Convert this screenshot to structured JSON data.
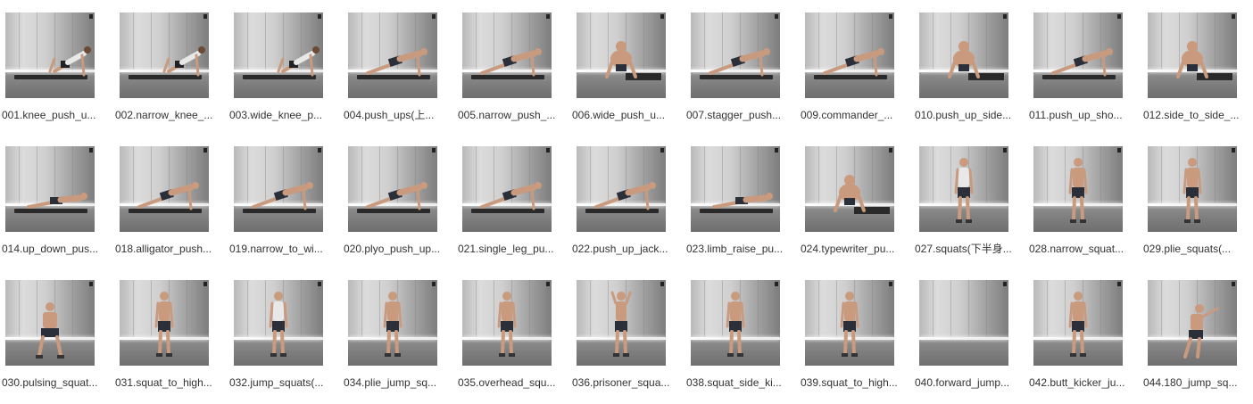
{
  "files": [
    {
      "label": "001.knee_push_u...",
      "pose": "plank-knee",
      "figure": "female"
    },
    {
      "label": "002.narrow_knee_...",
      "pose": "plank-knee",
      "figure": "female"
    },
    {
      "label": "003.wide_knee_p...",
      "pose": "plank-knee",
      "figure": "female"
    },
    {
      "label": "004.push_ups(上...",
      "pose": "plank",
      "figure": "male"
    },
    {
      "label": "005.narrow_push_...",
      "pose": "plank",
      "figure": "male"
    },
    {
      "label": "006.wide_push_u...",
      "pose": "plank-front",
      "figure": "male"
    },
    {
      "label": "007.stagger_push...",
      "pose": "plank",
      "figure": "male"
    },
    {
      "label": "009.commander_...",
      "pose": "plank",
      "figure": "male"
    },
    {
      "label": "010.push_up_side...",
      "pose": "plank-front",
      "figure": "male"
    },
    {
      "label": "011.push_up_sho...",
      "pose": "plank",
      "figure": "male"
    },
    {
      "label": "012.side_to_side_...",
      "pose": "plank-front",
      "figure": "male"
    },
    {
      "label": "014.up_down_pus...",
      "pose": "plank-low",
      "figure": "male"
    },
    {
      "label": "018.alligator_push...",
      "pose": "plank",
      "figure": "male"
    },
    {
      "label": "019.narrow_to_wi...",
      "pose": "plank",
      "figure": "male"
    },
    {
      "label": "020.plyo_push_up...",
      "pose": "plank",
      "figure": "male"
    },
    {
      "label": "021.single_leg_pu...",
      "pose": "plank",
      "figure": "male"
    },
    {
      "label": "022.push_up_jack...",
      "pose": "plank",
      "figure": "male"
    },
    {
      "label": "023.limb_raise_pu...",
      "pose": "plank-low",
      "figure": "male"
    },
    {
      "label": "024.typewriter_pu...",
      "pose": "plank-front",
      "figure": "male"
    },
    {
      "label": "027.squats(下半身...",
      "pose": "stand",
      "figure": "female"
    },
    {
      "label": "028.narrow_squat...",
      "pose": "stand",
      "figure": "male"
    },
    {
      "label": "029.plie_squats(...",
      "pose": "stand",
      "figure": "male"
    },
    {
      "label": "030.pulsing_squat...",
      "pose": "squat",
      "figure": "male"
    },
    {
      "label": "031.squat_to_high...",
      "pose": "stand",
      "figure": "male"
    },
    {
      "label": "032.jump_squats(...",
      "pose": "stand",
      "figure": "female"
    },
    {
      "label": "034.plie_jump_sq...",
      "pose": "stand",
      "figure": "male"
    },
    {
      "label": "035.overhead_squ...",
      "pose": "stand",
      "figure": "male"
    },
    {
      "label": "036.prisoner_squa...",
      "pose": "stand-arms",
      "figure": "male"
    },
    {
      "label": "038.squat_side_ki...",
      "pose": "stand",
      "figure": "male"
    },
    {
      "label": "039.squat_to_high...",
      "pose": "stand-front",
      "figure": "male"
    },
    {
      "label": "040.forward_jump...",
      "pose": "empty",
      "figure": "none"
    },
    {
      "label": "042.butt_kicker_ju...",
      "pose": "stand",
      "figure": "male"
    },
    {
      "label": "044.180_jump_sq...",
      "pose": "jump",
      "figure": "male"
    }
  ],
  "colors": {
    "label_text": "#333333",
    "background": "#ffffff",
    "skin": "#c99a7e",
    "shorts_dark": "#2b2f3a",
    "top_light": "#e8e8e8"
  }
}
